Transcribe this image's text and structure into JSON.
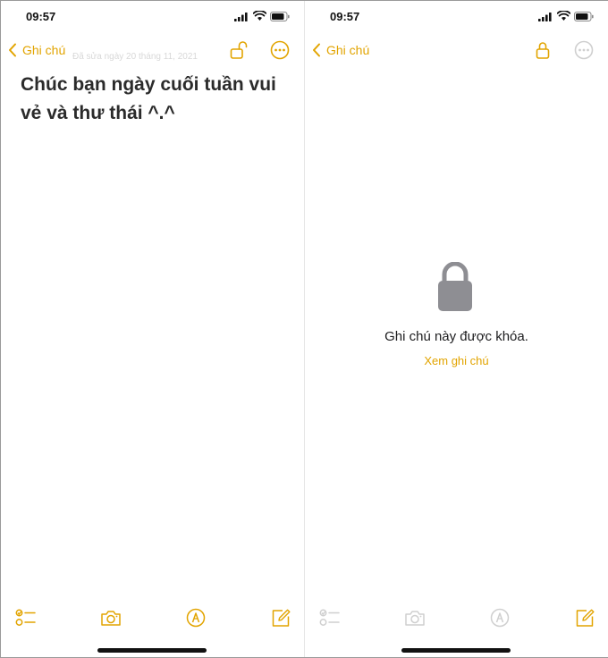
{
  "colors": {
    "accent": "#e2a400",
    "accent_muted": "#f0d98a",
    "icon_disabled": "#cfcfcf",
    "lock_gray": "#8e8e93"
  },
  "left": {
    "status_time": "09:57",
    "nav": {
      "back_label": "Ghi chú",
      "lock_icon": "unlocked-padlock-icon",
      "more_icon": "ellipsis-circle-icon"
    },
    "date_text": "Đã sửa ngày 20 tháng 11, 2021",
    "note_text": "Chúc bạn ngày cuối tuần vui vẻ và thư thái ^.^",
    "toolbar": [
      "checklist-icon",
      "camera-icon",
      "markup-pen-icon",
      "compose-icon"
    ]
  },
  "right": {
    "status_time": "09:57",
    "nav": {
      "back_label": "Ghi chú",
      "lock_icon": "locked-padlock-icon",
      "more_icon": "ellipsis-circle-icon"
    },
    "locked_message": "Ghi chú này được khóa.",
    "view_note_label": "Xem ghi chú",
    "toolbar": [
      "checklist-icon",
      "camera-icon",
      "markup-pen-icon",
      "compose-icon"
    ]
  }
}
